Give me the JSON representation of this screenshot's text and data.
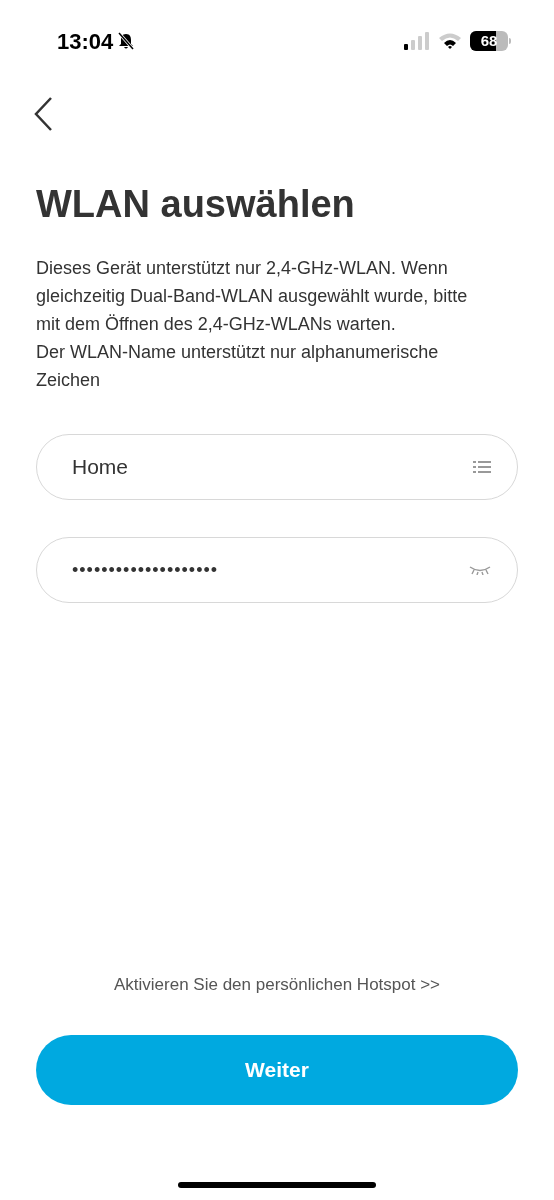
{
  "status_bar": {
    "time": "13:04",
    "battery": "68"
  },
  "title": "WLAN auswählen",
  "description": [
    "Dieses Gerät unterstützt nur 2,4-GHz-WLAN. Wenn gleichzeitig Dual-Band-WLAN ausgewählt wurde, bitte mit dem Öffnen des 2,4-GHz-WLANs warten.",
    "Der WLAN-Name unterstützt nur alphanumerische Zeichen"
  ],
  "fields": [
    {
      "kind": "network",
      "value": "Home"
    },
    {
      "kind": "password",
      "value": "••••••••••••••••••••"
    }
  ],
  "hotspot_link": "Aktivieren Sie den persönlichen Hotspot >>",
  "next_button": "Weiter"
}
